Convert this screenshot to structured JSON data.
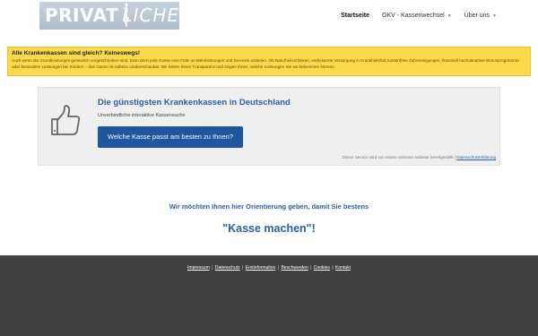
{
  "header": {
    "logo_left": "PRIVAT",
    "logo_right": "LICHE",
    "nav": [
      {
        "label": "Startseite",
        "active": true,
        "has_dropdown": false
      },
      {
        "label": "GKV - Kassenwechsel",
        "active": false,
        "has_dropdown": true
      },
      {
        "label": "Über uns",
        "active": false,
        "has_dropdown": true
      }
    ]
  },
  "notice": {
    "title": "Alle Krankenkassen sind gleich? Keineswegs!",
    "text": "Auch wenn die Grundleistungen gesetzlich vorgeschrieben sind, kann doch jede Kasse eine Fülle an Mehrleistungen und Services anbieten. Ob Naturheilverfahren, verbesserte Versorgung in Krankheitsfall, kostenfreie Zahnreinigungen, finanziell hochattraktive Bonusprogramme oder besondere Leistungen bei Kindern – das Ganze ist nahezu unüberschaubar. Wir bieten Ihnen Transparenz und zeigen Ihnen, welche Leistungen Sie wo bekommen können.",
    "bg_color": "#fcd94a"
  },
  "box": {
    "icon": "thumbs-up-icon",
    "title": "Die günstigsten Krankenkassen in Deutschland",
    "subtitle": "Unverbindliche interaktive Kassensuche",
    "button_label": "Welche Kasse passt am besten zu Ihnen?",
    "note_text": "Dieser Service wird von einem externen Anbieter bereitgestellt |",
    "note_link": "Datenschutzerklärung"
  },
  "orientation": {
    "line1": "Wir möchten Ihnen hier Orientierung geben, damit Sie bestens",
    "line2": "\"Kasse machen\"!"
  },
  "footer": {
    "links": [
      "Impressum",
      "Datenschutz",
      "Erstinformation",
      "Beschwerden",
      "Cookies",
      "Kontakt"
    ],
    "separator": "|"
  },
  "colors": {
    "accent": "#2b5fa8",
    "button": "#1e56a0",
    "footer_bg": "#404040"
  }
}
